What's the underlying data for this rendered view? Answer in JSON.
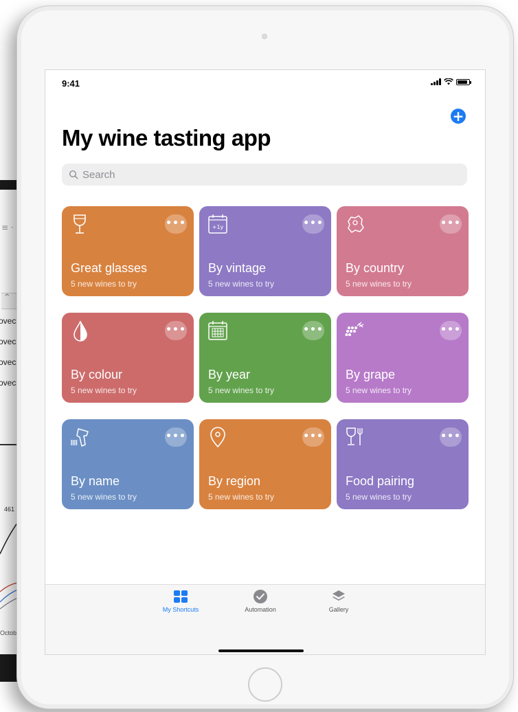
{
  "background_laptop": {
    "cells": [
      "ovec",
      "ovec",
      "ovec",
      "ovec"
    ],
    "number": "461",
    "month": "Octob"
  },
  "status_bar": {
    "time": "9:41",
    "battery_level": 0.9
  },
  "page": {
    "title": "My wine tasting app",
    "add_icon": "plus-circle-icon"
  },
  "search": {
    "placeholder": "Search"
  },
  "cards": [
    {
      "title": "Great glasses",
      "subtitle": "5 new wines to try",
      "color": "#d8823f",
      "icon": "wine-glass-icon"
    },
    {
      "title": "By vintage",
      "subtitle": "5 new wines to try",
      "color": "#8d79c4",
      "icon": "calendar-plus-one-year-icon"
    },
    {
      "title": "By country",
      "subtitle": "5 new wines to try",
      "color": "#d27a90",
      "icon": "globe-map-icon"
    },
    {
      "title": "By colour",
      "subtitle": "5 new wines to try",
      "color": "#cd6b6b",
      "icon": "drop-icon"
    },
    {
      "title": "By year",
      "subtitle": "5 new wines to try",
      "color": "#62a24d",
      "icon": "calendar-grid-icon"
    },
    {
      "title": "By grape",
      "subtitle": "5 new wines to try",
      "color": "#b77ac9",
      "icon": "grapes-icon"
    },
    {
      "title": "By name",
      "subtitle": "5 new wines to try",
      "color": "#6b8fc4",
      "icon": "barcode-scanner-icon"
    },
    {
      "title": "By region",
      "subtitle": "5 new wines to try",
      "color": "#d8823f",
      "icon": "location-pin-icon"
    },
    {
      "title": "Food pairing",
      "subtitle": "5 new wines to try",
      "color": "#8d79c4",
      "icon": "glass-and-fork-icon"
    }
  ],
  "more_label": "•••",
  "tabs": [
    {
      "label": "My Shortcuts",
      "icon": "grid-squares-icon",
      "active": true,
      "color": "#1c7cf2"
    },
    {
      "label": "Automation",
      "icon": "clock-check-icon",
      "active": false,
      "color": "#555555"
    },
    {
      "label": "Gallery",
      "icon": "layers-icon",
      "active": false,
      "color": "#555555"
    }
  ]
}
